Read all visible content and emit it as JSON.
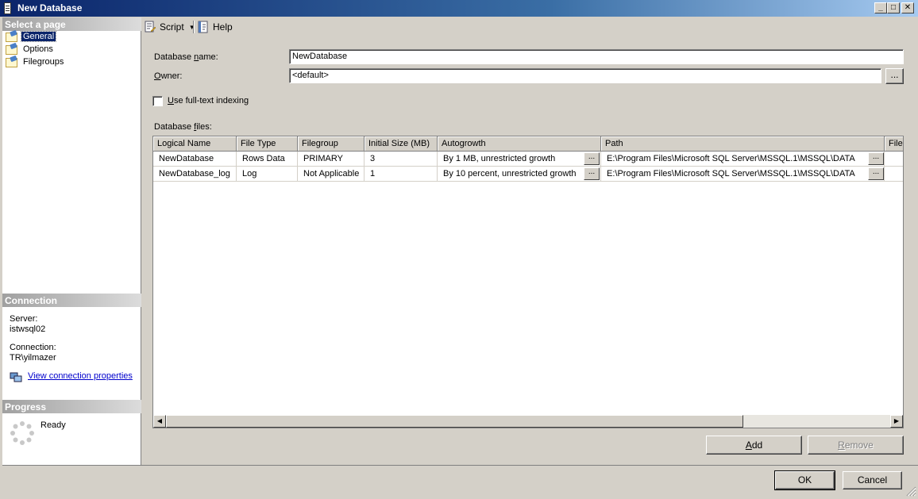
{
  "window": {
    "title": "New Database"
  },
  "left": {
    "select_page_header": "Select a page",
    "pages": [
      {
        "label": "General"
      },
      {
        "label": "Options"
      },
      {
        "label": "Filegroups"
      }
    ],
    "connection_header": "Connection",
    "server_label": "Server:",
    "server_value": "istwsql02",
    "connection_label": "Connection:",
    "connection_value": "TR\\yilmazer",
    "view_connection_link": "View connection properties",
    "progress_header": "Progress",
    "progress_status": "Ready"
  },
  "toolbar": {
    "script_label": "Script",
    "help_label": "Help"
  },
  "form": {
    "db_name_label_pre": "Database ",
    "db_name_label_u": "n",
    "db_name_label_post": "ame:",
    "db_name_value": "NewDatabase",
    "owner_label_u": "O",
    "owner_label_post": "wner:",
    "owner_value": "<default>",
    "owner_browse": "...",
    "fulltext_u": "U",
    "fulltext_post": "se full-text indexing",
    "fulltext_checked": false,
    "db_files_label_pre": "Database ",
    "db_files_label_u": "f",
    "db_files_label_post": "iles:"
  },
  "grid": {
    "columns": [
      "Logical Name",
      "File Type",
      "Filegroup",
      "Initial Size (MB)",
      "Autogrowth",
      "Path",
      "File"
    ],
    "rows": [
      {
        "logical_name": "NewDatabase",
        "file_type": "Rows Data",
        "filegroup": "PRIMARY",
        "initial_size": "3",
        "autogrowth": "By 1 MB, unrestricted growth",
        "path": "E:\\Program Files\\Microsoft SQL Server\\MSSQL.1\\MSSQL\\DATA",
        "file": ""
      },
      {
        "logical_name": "NewDatabase_log",
        "file_type": "Log",
        "filegroup": "Not Applicable",
        "initial_size": "1",
        "autogrowth": "By 10 percent, unrestricted growth",
        "path": "E:\\Program Files\\Microsoft SQL Server\\MSSQL.1\\MSSQL\\DATA",
        "file": ""
      }
    ],
    "ellipsis": "..."
  },
  "buttons": {
    "add_u": "A",
    "add_post": "dd",
    "remove_u": "R",
    "remove_post": "emove",
    "ok": "OK",
    "cancel": "Cancel"
  },
  "window_buttons": {
    "minimize": "_",
    "maximize": "□",
    "close": "✕"
  }
}
